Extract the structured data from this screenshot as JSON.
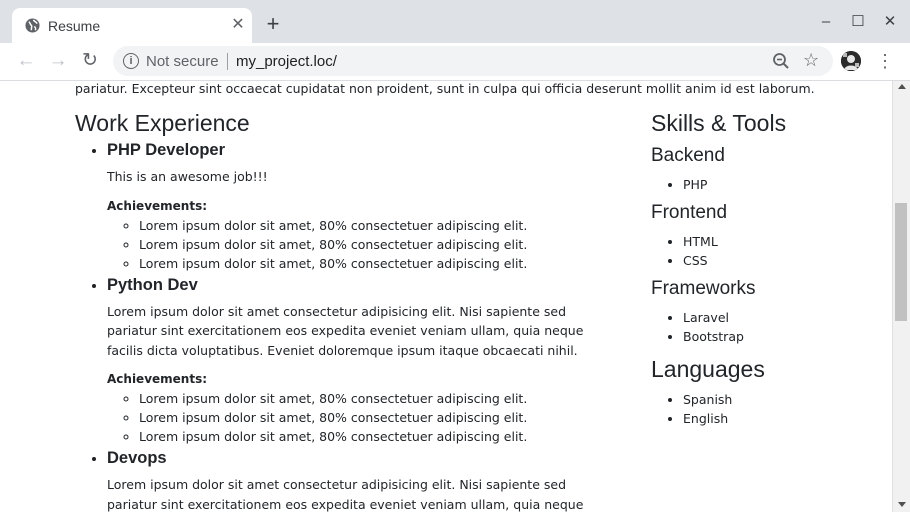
{
  "browser": {
    "tab_title": "Resume",
    "address_security": "Not secure",
    "address_url": "my_project.loc/"
  },
  "page": {
    "top_text": "pariatur. Excepteur sint occaecat cupidatat non proident, sunt in culpa qui officia deserunt mollit anim id est laborum.",
    "work": {
      "heading": "Work Experience",
      "jobs": [
        {
          "title": "PHP Developer",
          "description": "This is an awesome job!!!",
          "achievements_label": "Achievements:",
          "achievements": [
            "Lorem ipsum dolor sit amet, 80% consectetuer adipiscing elit.",
            "Lorem ipsum dolor sit amet, 80% consectetuer adipiscing elit.",
            "Lorem ipsum dolor sit amet, 80% consectetuer adipiscing elit."
          ]
        },
        {
          "title": "Python Dev",
          "description": "Lorem ipsum dolor sit amet consectetur adipisicing elit. Nisi sapiente sed pariatur sint exercitationem eos expedita eveniet veniam ullam, quia neque facilis dicta voluptatibus. Eveniet doloremque ipsum itaque obcaecati nihil.",
          "achievements_label": "Achievements:",
          "achievements": [
            "Lorem ipsum dolor sit amet, 80% consectetuer adipiscing elit.",
            "Lorem ipsum dolor sit amet, 80% consectetuer adipiscing elit.",
            "Lorem ipsum dolor sit amet, 80% consectetuer adipiscing elit."
          ]
        },
        {
          "title": "Devops",
          "description": "Lorem ipsum dolor sit amet consectetur adipisicing elit. Nisi sapiente sed pariatur sint exercitationem eos expedita eveniet veniam ullam, quia neque facilis dicta voluptatibus."
        }
      ]
    },
    "skills": {
      "heading": "Skills & Tools",
      "groups": [
        {
          "title": "Backend",
          "items": [
            "PHP"
          ]
        },
        {
          "title": "Frontend",
          "items": [
            "HTML",
            "CSS"
          ]
        },
        {
          "title": "Frameworks",
          "items": [
            "Laravel",
            "Bootstrap"
          ]
        }
      ]
    },
    "languages": {
      "heading": "Languages",
      "items": [
        "Spanish",
        "English"
      ]
    }
  },
  "icons": {
    "tab": "globe-icon",
    "close": "close-icon",
    "new_tab": "plus-icon",
    "back": "back-arrow-icon",
    "forward": "forward-arrow-icon",
    "reload": "reload-icon",
    "info": "info-icon",
    "zoom": "zoom-out-icon",
    "bookmark": "star-icon",
    "profile": "avatar",
    "menu": "kebab-menu-icon"
  }
}
